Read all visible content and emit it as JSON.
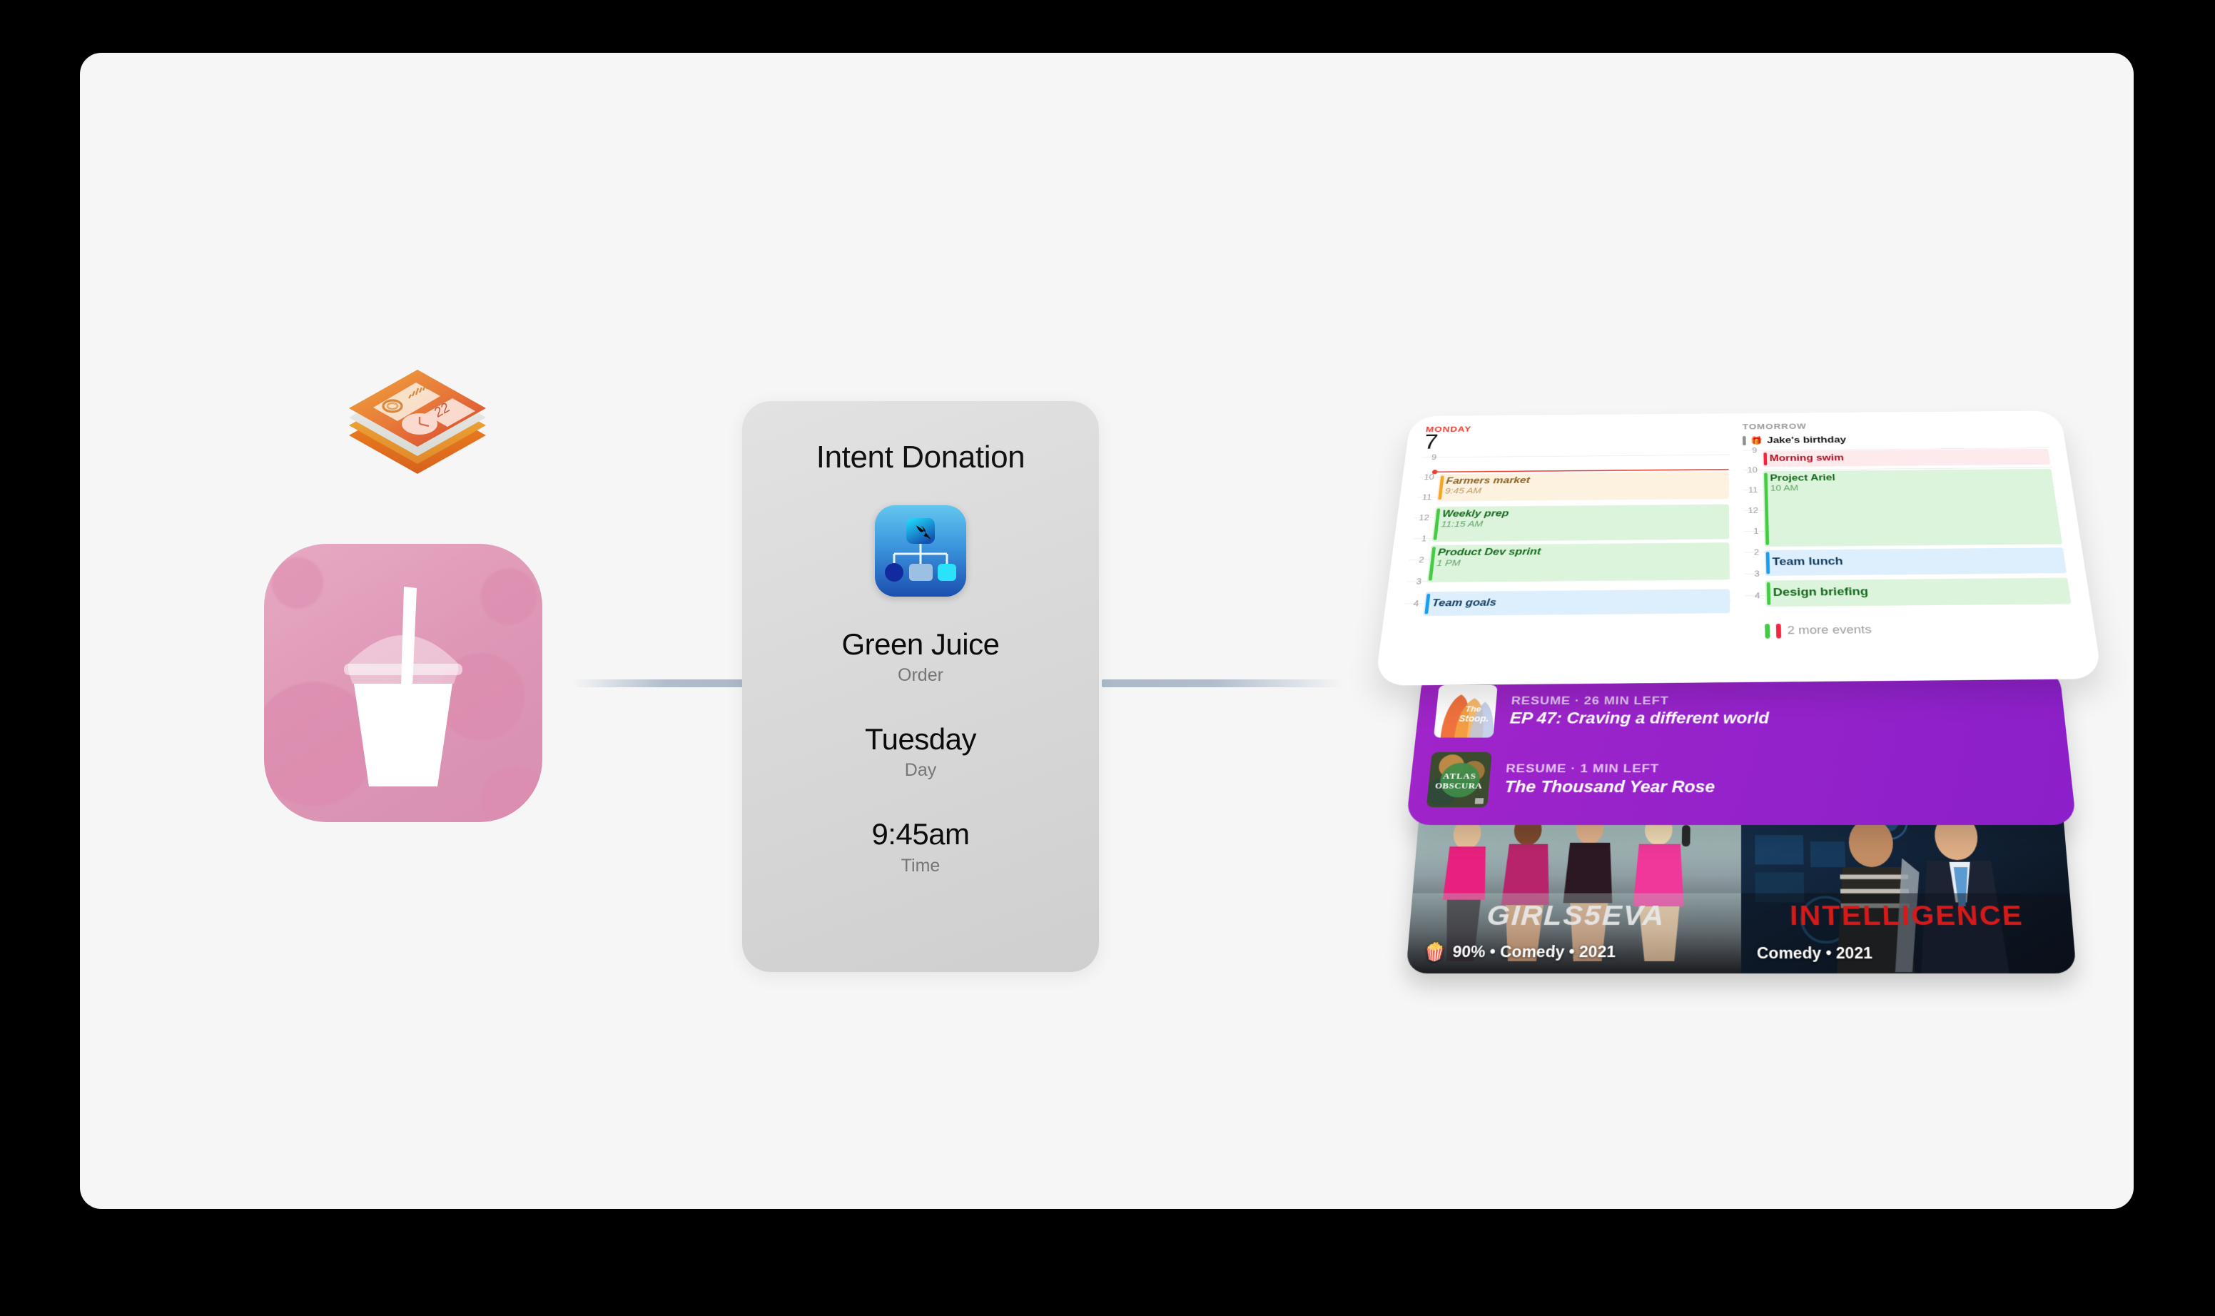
{
  "colors": {
    "canvas_background": "#f6f6f6",
    "page_background": "#000000",
    "rail": "#acb9c9",
    "card_background": "#d9d9d9",
    "podcast_purple": "#9422cb",
    "calendar_red": "#f03b2d",
    "event_green": "#43cb42",
    "event_blue": "#18a0f0",
    "event_orange": "#f5a623",
    "juice_pink": "#dd96b5"
  },
  "left_icons": {
    "widgetkit": {
      "name": "widgetkit-framework-icon",
      "widget_tiles": {
        "activity_rings": "activity-rings",
        "waveform": "audio-waveform",
        "clock": "analog-clock",
        "calendar_weekday": "MON",
        "calendar_daynum": "22"
      }
    },
    "app": {
      "name": "green-juice-app-icon",
      "subject": "smoothie-cup-with-straw"
    }
  },
  "intent_card": {
    "title": "Intent Donation",
    "app_icon_name": "sirikit-intents-icon",
    "fields": [
      {
        "value": "Green Juice",
        "label": "Order"
      },
      {
        "value": "Tuesday",
        "label": "Day"
      },
      {
        "value": "9:45am",
        "label": "Time"
      }
    ]
  },
  "calendar_widget": {
    "left_column": {
      "header": "MONDAY",
      "day_number": "7",
      "hours": [
        "9",
        "10",
        "11",
        "12",
        "1",
        "2",
        "3",
        "4"
      ],
      "events": [
        {
          "title": "Farmers market",
          "time": "9:45 AM",
          "color": "orange"
        },
        {
          "title": "Weekly prep",
          "time": "11:15 AM",
          "color": "green"
        },
        {
          "title": "Product Dev sprint",
          "time": "1 PM",
          "color": "green"
        },
        {
          "title": "Team goals",
          "time": "",
          "color": "blue"
        }
      ]
    },
    "right_column": {
      "header": "TOMORROW",
      "all_day_event": "Jake's birthday",
      "all_day_icon": "gift-icon",
      "hours": [
        "9",
        "10",
        "11",
        "12",
        "1",
        "2",
        "3",
        "4"
      ],
      "events": [
        {
          "title": "Morning swim",
          "time": "",
          "color": "red"
        },
        {
          "title": "Project Ariel",
          "time": "10 AM",
          "color": "green"
        },
        {
          "title": "Team lunch",
          "time": "",
          "color": "blue"
        },
        {
          "title": "Design briefing",
          "time": "",
          "color": "green"
        }
      ],
      "more_events": "2 more events"
    }
  },
  "podcast_widget": {
    "rows": [
      {
        "art_name": "the-stoop-artwork",
        "art_title": "The Stoop.",
        "meta": "RESUME · 26 MIN LEFT",
        "title": "EP 47: Craving a different world"
      },
      {
        "art_name": "atlas-obscura-artwork",
        "art_title": "ATLAS OBSCURA",
        "meta": "RESUME · 1 MIN LEFT",
        "title": "The Thousand Year Rose"
      }
    ]
  },
  "tv_widget": {
    "tiles": [
      {
        "logo": "GIRLS5EVA",
        "rating_icon": "popcorn-icon",
        "rating": "90%",
        "genre": "Comedy",
        "year": "2021",
        "caption": "90% • Comedy • 2021"
      },
      {
        "logo": "INTELLIGENCE",
        "rating_icon": "",
        "rating": "",
        "genre": "Comedy",
        "year": "2021",
        "caption": "Comedy • 2021"
      }
    ]
  }
}
